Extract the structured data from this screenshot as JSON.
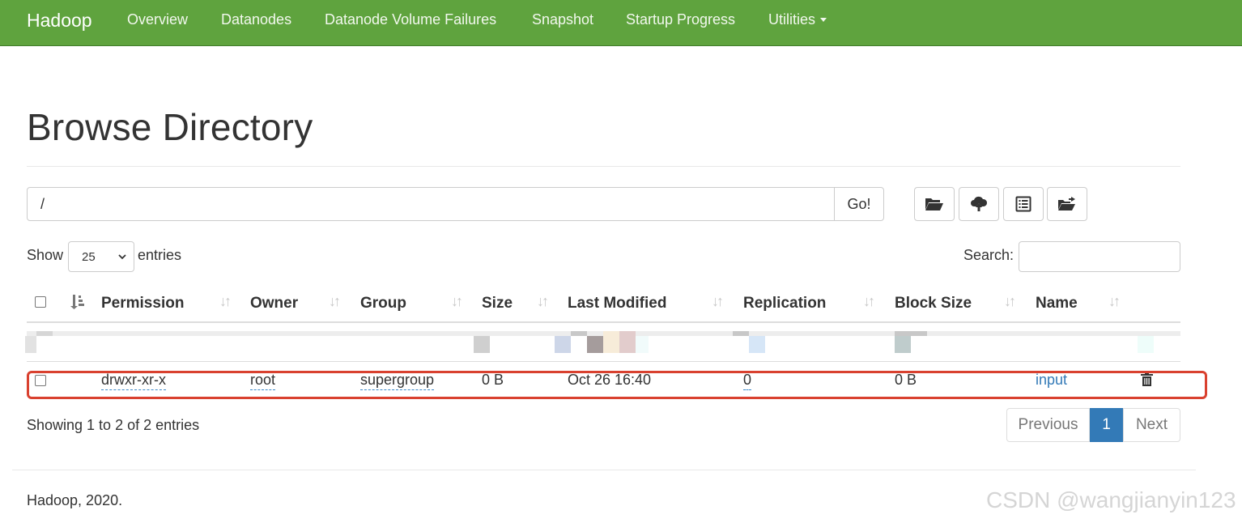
{
  "navbar": {
    "brand": "Hadoop",
    "items": [
      "Overview",
      "Datanodes",
      "Datanode Volume Failures",
      "Snapshot",
      "Startup Progress",
      "Utilities"
    ],
    "background": "#5fa33e"
  },
  "page": {
    "title": "Browse Directory"
  },
  "path_bar": {
    "value": "/",
    "go_label": "Go!"
  },
  "toolbar": {
    "icons": [
      "folder-open-icon",
      "cloud-upload-icon",
      "list-alt-icon",
      "folder-move-icon"
    ]
  },
  "entries": {
    "show_label": "Show",
    "selected": "25",
    "entries_label": "entries"
  },
  "search": {
    "label": "Search:",
    "value": ""
  },
  "table": {
    "columns": [
      "Permission",
      "Owner",
      "Group",
      "Size",
      "Last Modified",
      "Replication",
      "Block Size",
      "Name"
    ],
    "rows": [
      {
        "permission": "drwxr-xr-x",
        "owner": "root",
        "group": "supergroup",
        "size": "0 B",
        "last_modified": "Oct 26 16:40",
        "replication": "0",
        "block_size": "0 B",
        "name": "input"
      }
    ]
  },
  "summary": "Showing 1 to 2 of 2 entries",
  "pagination": {
    "previous": "Previous",
    "current": "1",
    "next": "Next",
    "active_color": "#337ab7"
  },
  "footer": "Hadoop, 2020.",
  "watermark": "CSDN @wangjianyin123",
  "highlight_color": "#d9412f"
}
